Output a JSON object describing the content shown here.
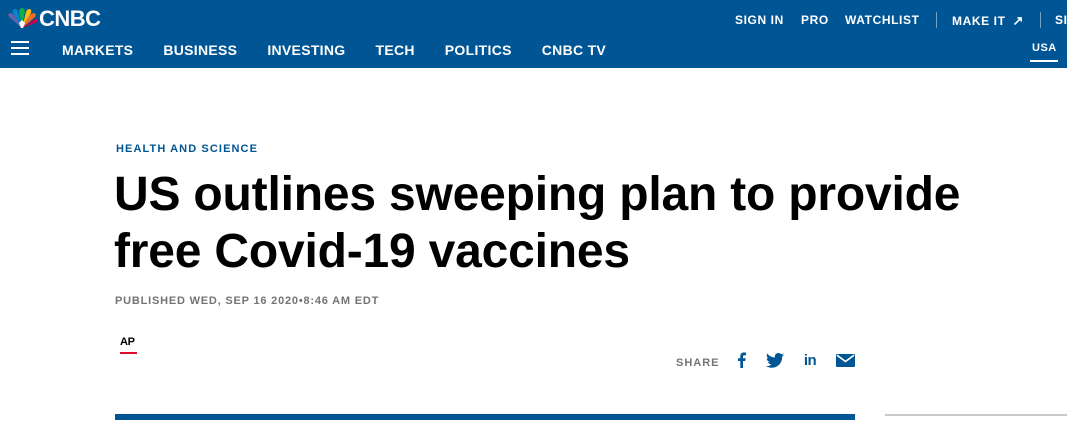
{
  "brand": {
    "logo_text": "CNBC",
    "logo_icon": "nbc-peacock-icon",
    "primary_color": "#005594"
  },
  "header": {
    "utility": {
      "sign_in": "SIGN IN",
      "pro": "PRO",
      "watchlist": "WATCHLIST",
      "make_it": "MAKE IT",
      "make_it_icon": "external-arrow-icon",
      "cut": "SI"
    },
    "nav": [
      "MARKETS",
      "BUSINESS",
      "INVESTING",
      "TECH",
      "POLITICS",
      "CNBC TV"
    ],
    "edition": "USA",
    "menu_icon": "hamburger-menu-icon"
  },
  "article": {
    "section": "HEALTH AND SCIENCE",
    "headline": "US outlines sweeping plan to provide free Covid-19 vaccines",
    "published": "PUBLISHED WED, SEP 16 2020•8:46 AM EDT",
    "source_logo": "AP",
    "source_accent": "#e00c2f"
  },
  "share": {
    "label": "SHARE",
    "icons": [
      "facebook-icon",
      "twitter-icon",
      "linkedin-icon",
      "email-icon"
    ]
  }
}
